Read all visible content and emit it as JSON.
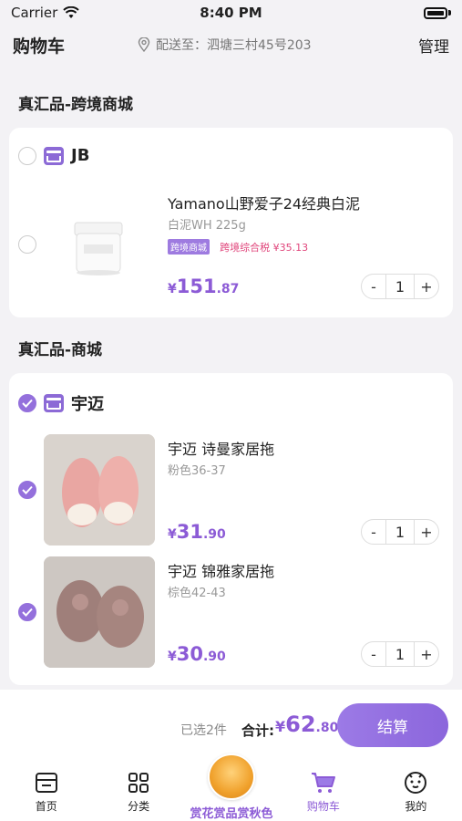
{
  "status": {
    "carrier": "Carrier",
    "time": "8:40 PM"
  },
  "header": {
    "title": "购物车",
    "address": "配送至：泗塘三村45号203",
    "manage": "管理"
  },
  "sections": [
    {
      "title": "真汇品-跨境商城",
      "shop": "JB",
      "shop_checked": false,
      "items": [
        {
          "name": "Yamano山野爱子24经典白泥",
          "spec": "白泥WH 225g",
          "tag": "跨境商城",
          "tax": "跨境综合税 ¥35.13",
          "price_int": "151",
          "price_dec": ".87",
          "qty": "1",
          "checked": false
        }
      ]
    },
    {
      "title": "真汇品-商城",
      "shop": "宇迈",
      "shop_checked": true,
      "items": [
        {
          "name": "宇迈 诗曼家居拖",
          "spec": "粉色36-37",
          "price_int": "31",
          "price_dec": ".90",
          "qty": "1",
          "checked": true
        },
        {
          "name": "宇迈 锦雅家居拖",
          "spec": "棕色42-43",
          "price_int": "30",
          "price_dec": ".90",
          "qty": "1",
          "checked": true
        }
      ]
    }
  ],
  "summary": {
    "selected": "已选2件",
    "total_label": "合计:",
    "currency": "¥",
    "total_int": "62",
    "total_dec": ".80",
    "checkout": "结算"
  },
  "tabbar": {
    "home": "首页",
    "category": "分类",
    "promo": "赏花赏品赏秋色",
    "cart": "购物车",
    "mine": "我的"
  },
  "colors": {
    "accent": "#8c5bd6",
    "tax": "#e0457b",
    "background": "#f3f2f5"
  },
  "controls": {
    "minus": "-",
    "plus": "+",
    "yuan": "¥"
  }
}
